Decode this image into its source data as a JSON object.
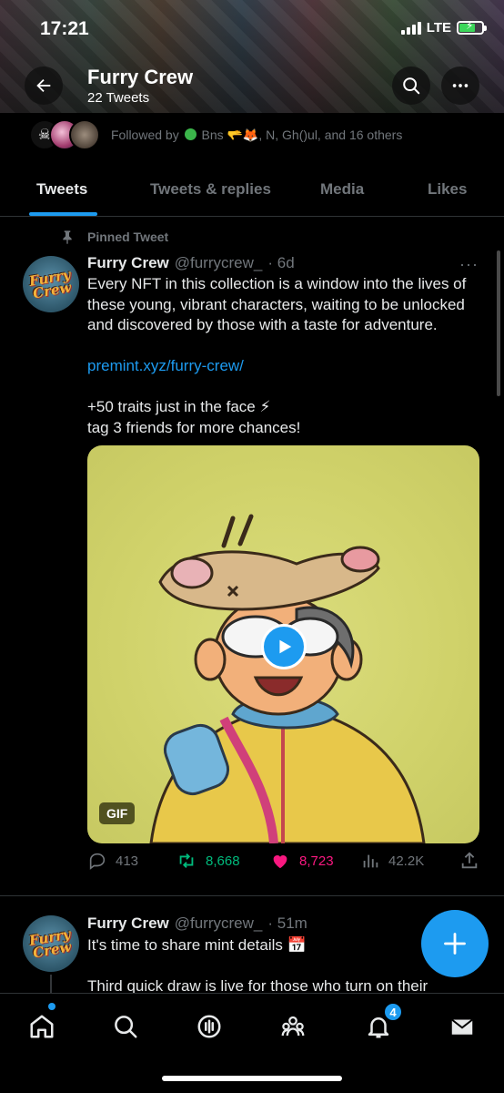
{
  "status_bar": {
    "time": "17:21",
    "network": "LTE"
  },
  "header": {
    "title": "Furry Crew",
    "subtitle": "22 Tweets"
  },
  "followed_by": {
    "prefix": "Followed by",
    "names": "Bns 🫳🦊, N, Gh()ul, and 16 others"
  },
  "tabs": [
    {
      "label": "Tweets",
      "active": true
    },
    {
      "label": "Tweets & replies",
      "active": false
    },
    {
      "label": "Media",
      "active": false
    },
    {
      "label": "Likes",
      "active": false
    }
  ],
  "tweets": [
    {
      "pinned_label": "Pinned Tweet",
      "name": "Furry Crew",
      "handle": "@furrycrew_",
      "time": "· 6d",
      "lines": [
        "Every NFT in this collection is a window into the lives of these young, vibrant characters, waiting to be unlocked and discovered by those with a taste for adventure."
      ],
      "link": "premint.xyz/furry-crew/",
      "lines2": [
        "+50 traits just in the face ⚡",
        "tag 3 friends for more chances!"
      ],
      "media_badge": "GIF",
      "stats": {
        "replies": "413",
        "retweets": "8,668",
        "likes": "8,723",
        "views": "42.2K"
      }
    },
    {
      "name": "Furry Crew",
      "handle": "@furrycrew_",
      "time": "· 51m",
      "line1": "It's time to share mint details 📅",
      "line2": "Third quick draw is live for those who turn on their"
    }
  ],
  "avatar_text": "Furry Crew",
  "bottom_nav": {
    "notifications_count": "4"
  },
  "colors": {
    "accent": "#1d9bf0",
    "retweet": "#00ba7c",
    "like": "#f91880",
    "muted": "#71767b"
  }
}
